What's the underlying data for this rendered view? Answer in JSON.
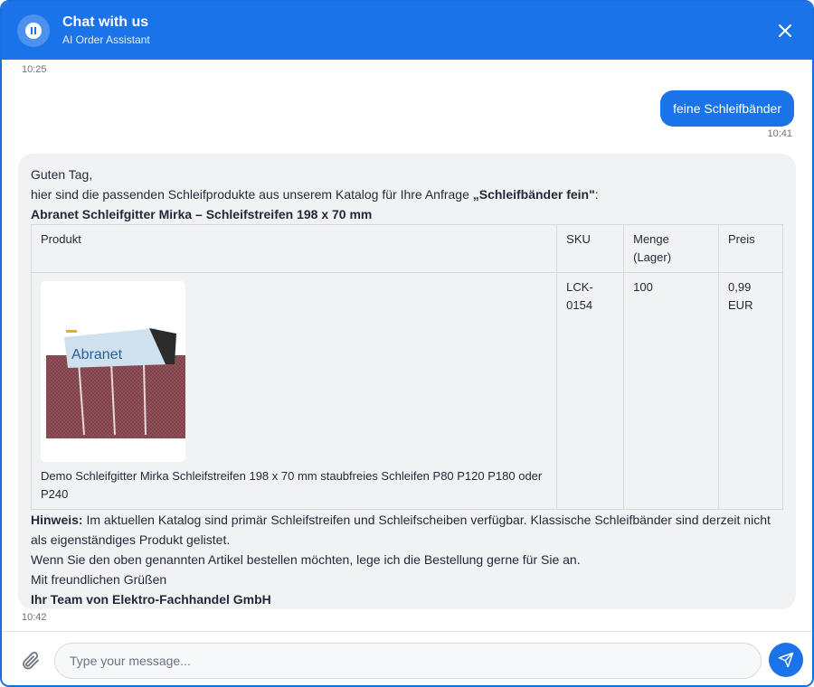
{
  "header": {
    "title": "Chat with us",
    "subtitle": "AI Order Assistant"
  },
  "messages": {
    "first_timestamp": "10:25",
    "user_message": {
      "text": "feine Schleifbänder",
      "time": "10:41"
    },
    "bot_message": {
      "greeting": "Guten Tag,",
      "intro_text": "hier sind die passenden Schleifprodukte aus unserem Katalog für Ihre Anfrage ",
      "intro_query": "„Schleifbänder fein\"",
      "intro_colon": ":",
      "product_heading": "Abranet Schleifgitter Mirka – Schleifstreifen 198 x 70 mm",
      "table": {
        "headers": [
          "Produkt",
          "SKU",
          "Menge (Lager)",
          "Preis"
        ],
        "rows": [
          {
            "image_logo_text": "Abranet",
            "description": "Demo Schleifgitter Mirka Schleifstreifen 198 x 70 mm staubfreies Schleifen P80 P120 P180 oder P240",
            "sku": "LCK-0154",
            "quantity": "100",
            "price": "0,99 EUR"
          }
        ]
      },
      "note_label": "Hinweis:",
      "note_text": " Im aktuellen Katalog sind primär Schleifstreifen und Schleifscheiben verfügbar. Klassische Schleifbänder sind derzeit nicht als eigenständiges Produkt gelistet.",
      "order_offer": "Wenn Sie den oben genannten Artikel bestellen möchten, lege ich die Bestellung gerne für Sie an.",
      "closing": "Mit freundlichen Grüßen",
      "signature": "Ihr Team von Elektro-Fachhandel GmbH",
      "time": "10:42"
    }
  },
  "composer": {
    "placeholder": "Type your message..."
  },
  "icons": {
    "logo": "pause-circle-icon",
    "close": "close-icon",
    "attach": "paperclip-icon",
    "send": "send-icon"
  },
  "colors": {
    "primary": "#1a73e8",
    "bubble_bg": "#f1f2f4"
  }
}
